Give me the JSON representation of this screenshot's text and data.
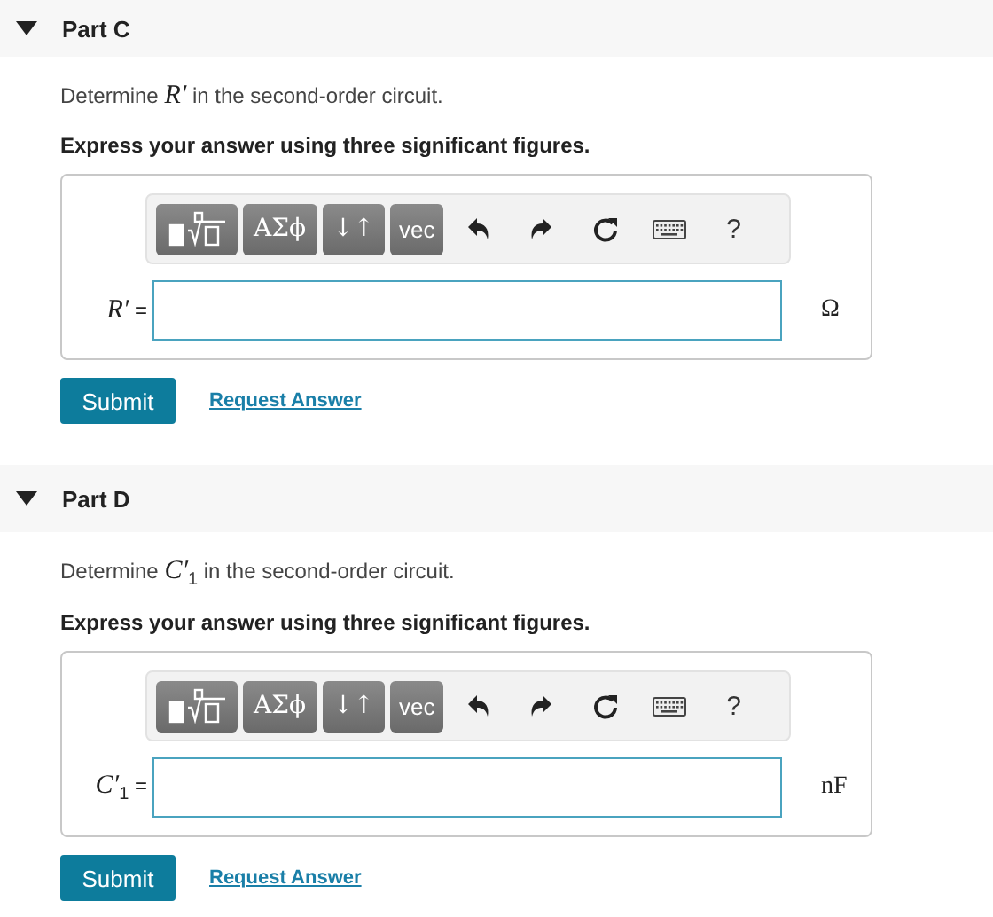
{
  "parts": [
    {
      "title": "Part C",
      "expanded": true,
      "prompt": "Determine *R′* in the second-order circuit.",
      "instruction": "Express your answer using three significant figures.",
      "toolbar": [
        {
          "kind": "templates"
        },
        {
          "kind": "text",
          "label": "ΑΣϕ"
        },
        {
          "kind": "text",
          "label": "↓↑"
        },
        {
          "kind": "text",
          "label": "vec"
        },
        {
          "kind": "undo"
        },
        {
          "kind": "redo"
        },
        {
          "kind": "reset"
        },
        {
          "kind": "keyboard"
        },
        {
          "kind": "help",
          "label": "?"
        }
      ],
      "variable": "*R′* =",
      "unit": "Ω",
      "submit": "Submit",
      "request": "Request Answer"
    },
    {
      "title": "Part D",
      "expanded": true,
      "prompt": "Determine *C′*$_{1}$ in the second-order circuit.",
      "instruction": "Express your answer using three significant figures.",
      "toolbar": [
        {
          "kind": "templates"
        },
        {
          "kind": "text",
          "label": "ΑΣϕ"
        },
        {
          "kind": "text",
          "label": "↓↑"
        },
        {
          "kind": "text",
          "label": "vec"
        },
        {
          "kind": "undo"
        },
        {
          "kind": "redo"
        },
        {
          "kind": "reset"
        },
        {
          "kind": "keyboard"
        },
        {
          "kind": "help",
          "label": "?"
        }
      ],
      "variable": "*C′*$_{1}$ =",
      "unit": "nF",
      "submit": "Submit",
      "request": "Request Answer"
    }
  ]
}
